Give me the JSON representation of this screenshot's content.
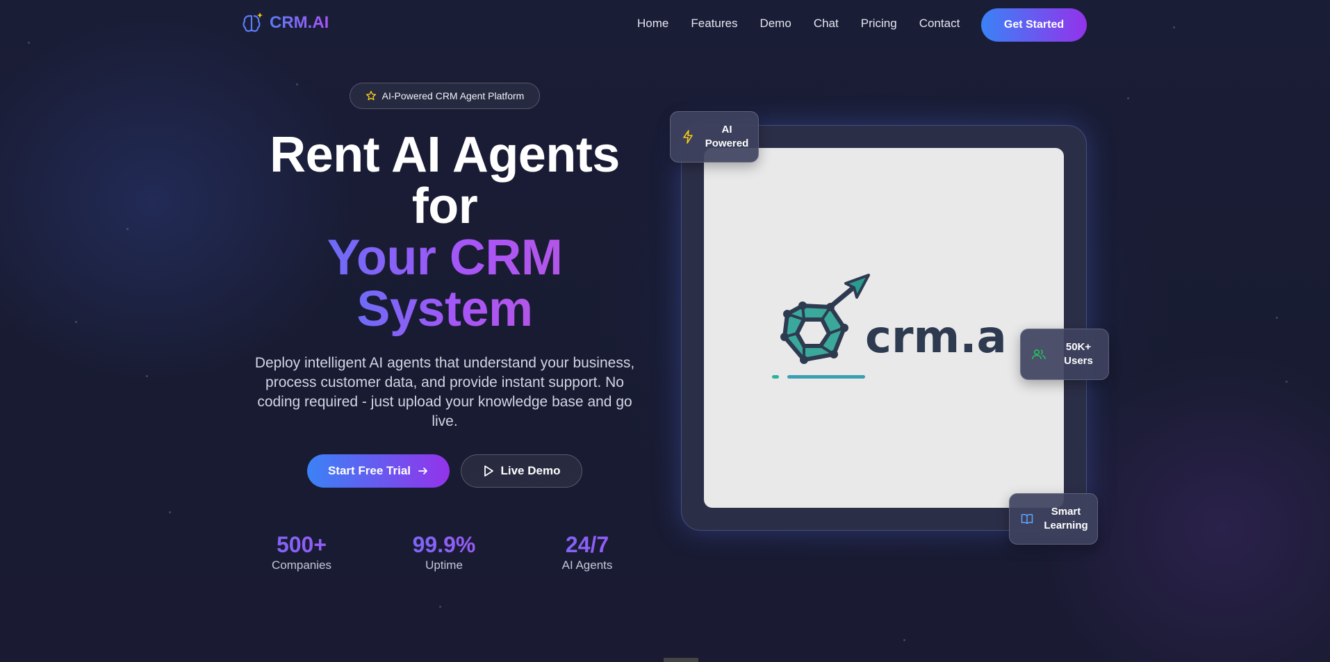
{
  "nav": {
    "brand": "CRM.AI",
    "links": [
      "Home",
      "Features",
      "Demo",
      "Chat",
      "Pricing",
      "Contact"
    ],
    "cta": "Get Started"
  },
  "hero": {
    "pill": "AI-Powered CRM Agent Platform",
    "headline_line1": "Rent AI Agents",
    "headline_line2": "for",
    "headline_line3": "Your CRM",
    "headline_line4": "System",
    "description": "Deploy intelligent AI agents that understand your business, process customer data, and provide instant support. No coding required - just upload your knowledge base and go live.",
    "primary_button": "Start Free Trial",
    "secondary_button": "Live Demo",
    "stats": [
      {
        "value": "500+",
        "label": "Companies"
      },
      {
        "value": "99.9%",
        "label": "Uptime"
      },
      {
        "value": "24/7",
        "label": "AI Agents"
      }
    ]
  },
  "showcase": {
    "brand_wordmark": "crm.ai",
    "badges": [
      {
        "text": "AI Powered",
        "icon": "lightning-icon"
      },
      {
        "text": "50K+ Users",
        "icon": "users-icon"
      },
      {
        "text": "Smart Learning",
        "icon": "book-icon"
      }
    ]
  },
  "colors": {
    "accent_start": "#3b82f6",
    "accent_end": "#9333ea",
    "background": "#181b33"
  }
}
